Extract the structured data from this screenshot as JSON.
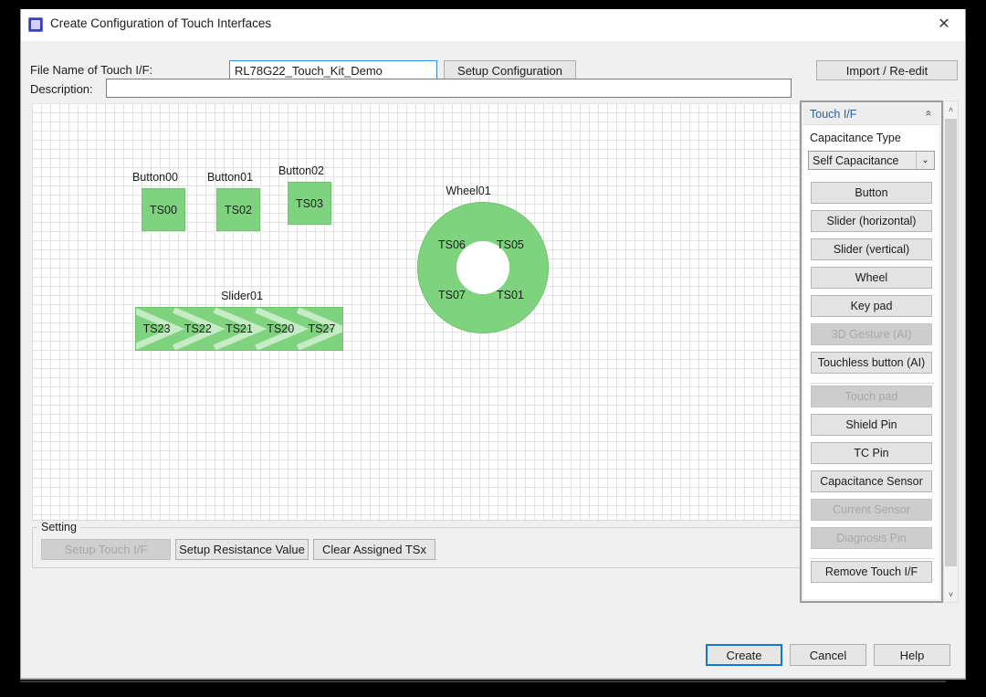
{
  "window": {
    "title": "Create Configuration of Touch Interfaces",
    "icon": "app-icon",
    "close_icon": "✕"
  },
  "form": {
    "file_name_label": "File Name of Touch I/F:",
    "file_name_value": "RL78G22_Touch_Kit_Demo",
    "description_label": "Description:",
    "description_value": "",
    "setup_configuration_label": "Setup Configuration",
    "import_reedit_label": "Import / Re-edit"
  },
  "canvas": {
    "buttons": [
      {
        "label": "Button00",
        "ts": "TS00"
      },
      {
        "label": "Button01",
        "ts": "TS02"
      },
      {
        "label": "Button02",
        "ts": "TS03"
      }
    ],
    "slider": {
      "label": "Slider01",
      "segments": [
        "TS23",
        "TS22",
        "TS21",
        "TS20",
        "TS27"
      ]
    },
    "wheel": {
      "label": "Wheel01",
      "segments": {
        "top_left": "TS06",
        "top_right": "TS05",
        "bottom_left": "TS07",
        "bottom_right": "TS01"
      }
    },
    "element_color": "#7fd37f"
  },
  "setting": {
    "group_title": "Setting",
    "setup_touch_if_label": "Setup Touch I/F",
    "setup_resistance_label": "Setup Resistance Value",
    "clear_assigned_label": "Clear Assigned TSx"
  },
  "panel": {
    "header_title": "Touch I/F",
    "collapse_icon": "«",
    "capacitance_type_label": "Capacitance Type",
    "capacitance_type_value": "Self Capacitance",
    "dropdown_icon": "⌄",
    "buttons": [
      {
        "label": "Button",
        "disabled": false
      },
      {
        "label": "Slider (horizontal)",
        "disabled": false
      },
      {
        "label": "Slider (vertical)",
        "disabled": false
      },
      {
        "label": "Wheel",
        "disabled": false
      },
      {
        "label": "Key pad",
        "disabled": false
      },
      {
        "label": "3D Gesture (AI)",
        "disabled": true
      },
      {
        "label": "Touchless button (AI)",
        "disabled": false
      },
      {
        "label": "Touch pad",
        "disabled": true
      },
      {
        "label": "Shield Pin",
        "disabled": false
      },
      {
        "label": "TC Pin",
        "disabled": false
      },
      {
        "label": "Capacitance Sensor",
        "disabled": false
      },
      {
        "label": "Current Sensor",
        "disabled": true
      },
      {
        "label": "Diagnosis Pin",
        "disabled": true
      },
      {
        "label": "Remove Touch I/F",
        "disabled": false
      }
    ],
    "header_color": "#2a6099"
  },
  "scrollbar": {
    "up_icon": "˄",
    "down_icon": "˅"
  },
  "footer": {
    "create_label": "Create",
    "cancel_label": "Cancel",
    "help_label": "Help",
    "accent_color": "#0a7ad4"
  }
}
